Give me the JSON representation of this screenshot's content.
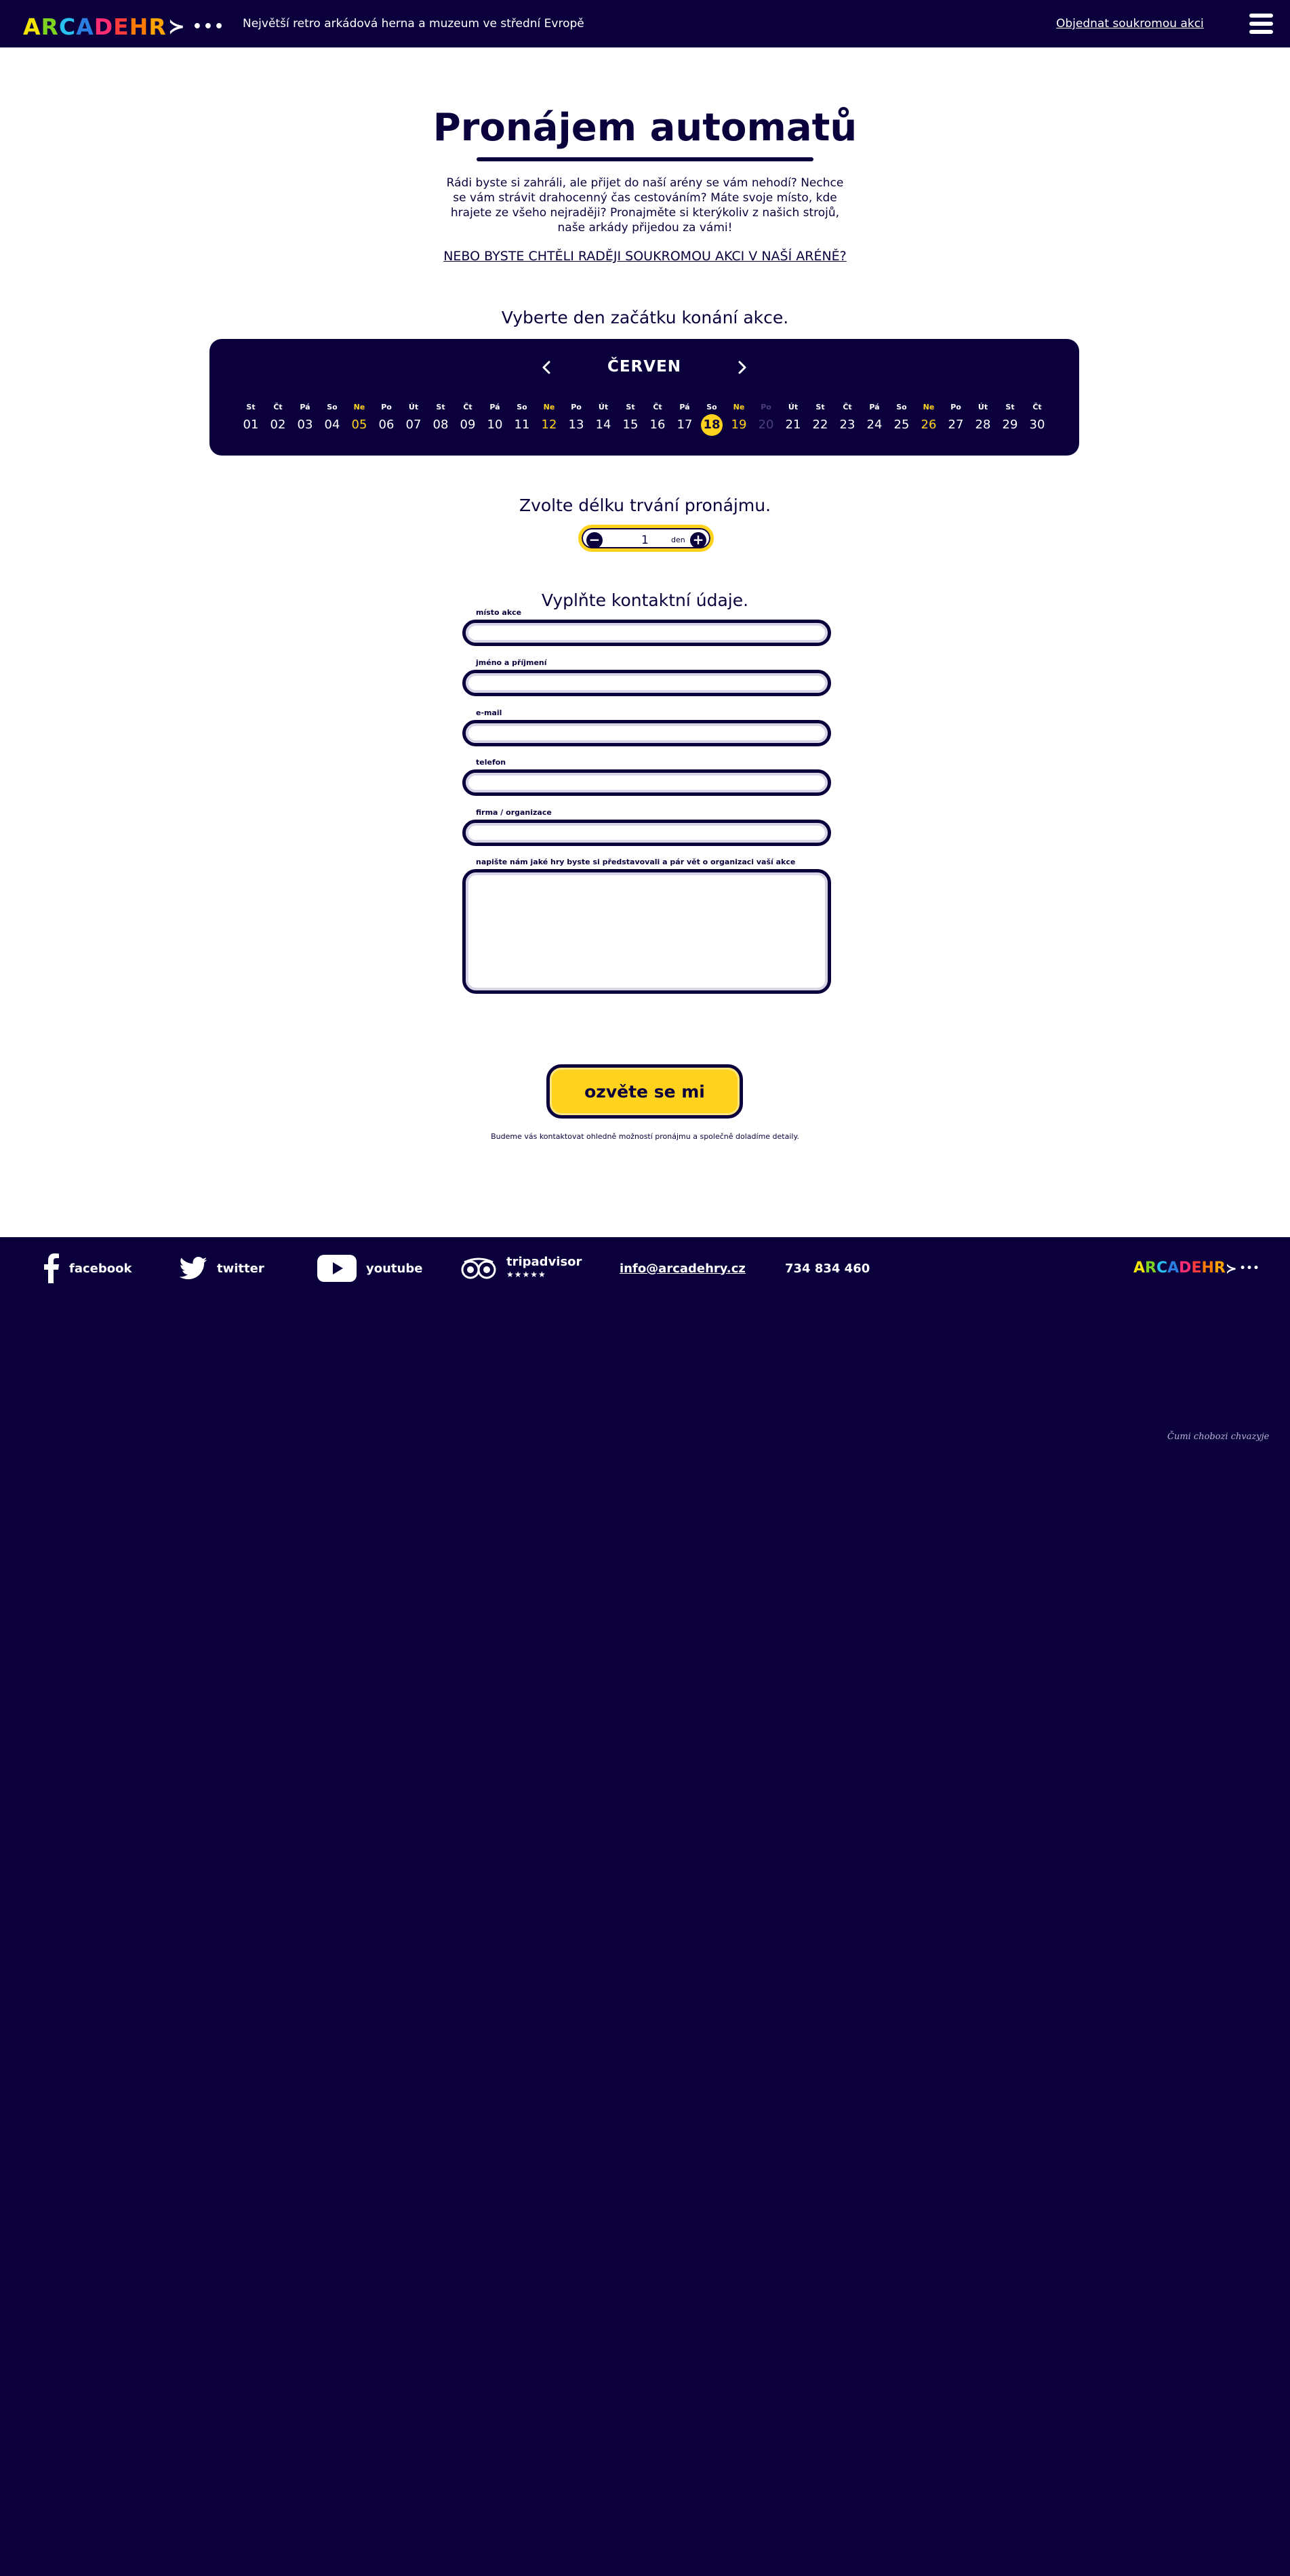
{
  "colors": {
    "brand_dark": "#0c003c",
    "accent_yellow": "#ffd21e",
    "white": "#ffffff"
  },
  "header": {
    "logo_letters": [
      {
        "ch": "A",
        "color": "#f2e500"
      },
      {
        "ch": "R",
        "color": "#7ed321"
      },
      {
        "ch": "C",
        "color": "#28c0ef"
      },
      {
        "ch": "A",
        "color": "#2a7de1"
      },
      {
        "ch": "D",
        "color": "#ff2d74"
      },
      {
        "ch": "E",
        "color": "#ff3b3b"
      },
      {
        "ch": "H",
        "color": "#ff7a00"
      },
      {
        "ch": "R",
        "color": "#ffa300"
      }
    ],
    "logo_arrow": "≻",
    "logo_dots": "•••",
    "tagline": "Největší retro arkádová herna a muzeum ve střední Evropě",
    "private_event_link": "Objednat soukromou akci",
    "menu_icon": "hamburger-icon"
  },
  "main": {
    "title": "Pronájem automatů",
    "intro": "Rádi byste si zahráli, ale přijet do naší arény se vám nehodí? Nechce se vám strávit drahocenný čas cestováním? Máte svoje místo, kde hrajete ze všeho nejraději? Pronajměte si kterýkoliv z našich strojů, naše arkády přijedou za vámi!",
    "private_cta": "NEBO BYSTE CHTĚLI RADĚJI SOUKROMOU AKCI V NAŠÍ ARÉNĚ?",
    "step_date": "Vyberte den začátku konání akce.",
    "step_duration": "Zvolte délku trvání pronájmu.",
    "step_contact": "Vyplňte kontaktní údaje."
  },
  "calendar": {
    "month": "ČERVEN",
    "prev_icon": "chevron-left-icon",
    "next_icon": "chevron-right-icon",
    "selected_day": "18",
    "days": [
      {
        "name": "St",
        "num": "01",
        "state": "normal"
      },
      {
        "name": "Čt",
        "num": "02",
        "state": "normal"
      },
      {
        "name": "Pá",
        "num": "03",
        "state": "normal"
      },
      {
        "name": "So",
        "num": "04",
        "state": "normal"
      },
      {
        "name": "Ne",
        "num": "05",
        "state": "weekend"
      },
      {
        "name": "Po",
        "num": "06",
        "state": "normal"
      },
      {
        "name": "Út",
        "num": "07",
        "state": "normal"
      },
      {
        "name": "St",
        "num": "08",
        "state": "normal"
      },
      {
        "name": "Čt",
        "num": "09",
        "state": "normal"
      },
      {
        "name": "Pá",
        "num": "10",
        "state": "normal"
      },
      {
        "name": "So",
        "num": "11",
        "state": "normal"
      },
      {
        "name": "Ne",
        "num": "12",
        "state": "weekend"
      },
      {
        "name": "Po",
        "num": "13",
        "state": "normal"
      },
      {
        "name": "Út",
        "num": "14",
        "state": "normal"
      },
      {
        "name": "St",
        "num": "15",
        "state": "normal"
      },
      {
        "name": "Čt",
        "num": "16",
        "state": "normal"
      },
      {
        "name": "Pá",
        "num": "17",
        "state": "normal"
      },
      {
        "name": "So",
        "num": "18",
        "state": "selected"
      },
      {
        "name": "Ne",
        "num": "19",
        "state": "weekend"
      },
      {
        "name": "Po",
        "num": "20",
        "state": "disabled"
      },
      {
        "name": "Út",
        "num": "21",
        "state": "normal"
      },
      {
        "name": "St",
        "num": "22",
        "state": "normal"
      },
      {
        "name": "Čt",
        "num": "23",
        "state": "normal"
      },
      {
        "name": "Pá",
        "num": "24",
        "state": "normal"
      },
      {
        "name": "So",
        "num": "25",
        "state": "normal"
      },
      {
        "name": "Ne",
        "num": "26",
        "state": "weekend"
      },
      {
        "name": "Po",
        "num": "27",
        "state": "normal"
      },
      {
        "name": "Út",
        "num": "28",
        "state": "normal"
      },
      {
        "name": "St",
        "num": "29",
        "state": "normal"
      },
      {
        "name": "Čt",
        "num": "30",
        "state": "normal"
      }
    ]
  },
  "duration": {
    "value": "1",
    "unit": "den",
    "minus_icon": "minus-icon",
    "plus_icon": "plus-icon"
  },
  "form": {
    "place_label": "místo akce",
    "place_value": "",
    "name_label": "jméno a příjmení",
    "name_value": "",
    "email_label": "e-mail",
    "email_value": "",
    "phone_label": "telefon",
    "phone_value": "",
    "company_label": "firma / organizace",
    "company_value": "",
    "message_label": "napište nám jaké hry byste si představovali a pár vět o organizaci vaší akce",
    "message_value": "",
    "submit_label": "ozvěte se mi",
    "note": "Budeme vás kontaktovat ohledně možností pronájmu a společně doladíme detaily."
  },
  "footer": {
    "facebook": "facebook",
    "twitter": "twitter",
    "youtube": "youtube",
    "tripadvisor": "tripadvisor",
    "tripadvisor_stars": "★★★★★",
    "email": "info@arcadehry.cz",
    "phone": "734 834 460",
    "credit": "Čumi chobozi chvazyje"
  }
}
